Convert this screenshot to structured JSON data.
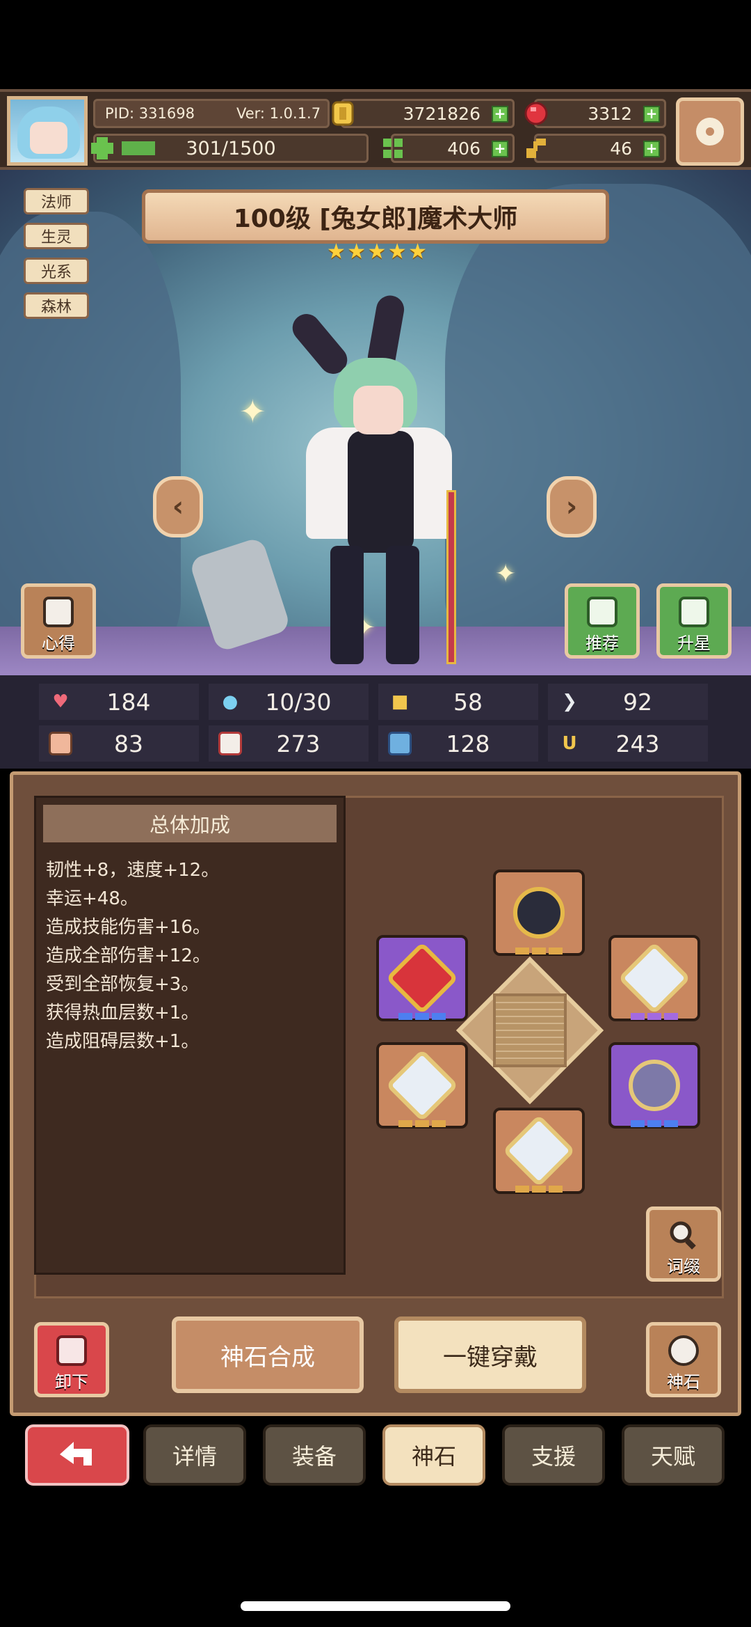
{
  "header": {
    "pid": "PID: 331698",
    "version": "Ver: 1.0.1.7",
    "exp": "301/1500",
    "gold": "3721826",
    "gems": "3312",
    "clover": "406",
    "key": "46"
  },
  "tags": [
    "法师",
    "生灵",
    "光系",
    "森林"
  ],
  "hero": {
    "title": "100级 [兔女郎]魔术大师",
    "stars": 5
  },
  "side_buttons": {
    "insight": "心得",
    "recommend": "推荐",
    "star_up": "升星"
  },
  "stats": [
    "184",
    "10/30",
    "58",
    "92",
    "83",
    "273",
    "128",
    "243"
  ],
  "bonus": {
    "title": "总体加成",
    "lines": [
      "韧性+8，速度+12。",
      "幸运+48。",
      "造成技能伤害+16。",
      "造成全部伤害+12。",
      "受到全部恢复+3。",
      "获得热血层数+1。",
      "造成阻碍层数+1。"
    ]
  },
  "actions": {
    "affix": "词缀",
    "unequip": "卸下",
    "synthesize": "神石合成",
    "one_click_equip": "一键穿戴",
    "godstone": "神石"
  },
  "tabs": [
    "详情",
    "装备",
    "神石",
    "支援",
    "天赋"
  ],
  "active_tab": "神石",
  "colors": {
    "accent_red": "#d9474b",
    "panel_brown": "#6f4f3c",
    "active_tab": "#f3e1be"
  }
}
